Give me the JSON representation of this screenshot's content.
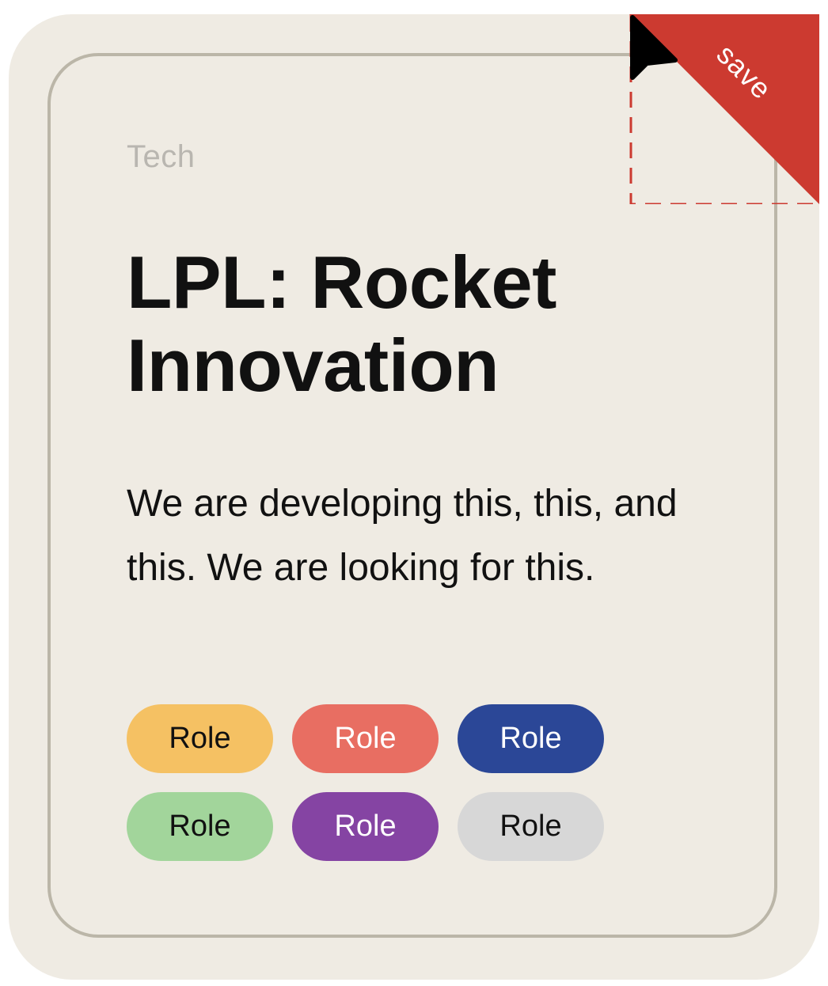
{
  "card": {
    "category": "Tech",
    "title": "LPL: Rocket Innovation",
    "description": "We are developing this, this, and this. We are looking for this.",
    "save_label": "save",
    "roles": [
      {
        "label": "Role",
        "bg": "#f5c163",
        "fg": "#111111"
      },
      {
        "label": "Role",
        "bg": "#e86e62",
        "fg": "#ffffff"
      },
      {
        "label": "Role",
        "bg": "#2b4797",
        "fg": "#ffffff"
      },
      {
        "label": "Role",
        "bg": "#a2d59b",
        "fg": "#111111"
      },
      {
        "label": "Role",
        "bg": "#8544a3",
        "fg": "#ffffff"
      },
      {
        "label": "Role",
        "bg": "#d7d7d7",
        "fg": "#111111"
      }
    ]
  },
  "colors": {
    "card_bg": "#efebe3",
    "frame_border": "#bbb6a8",
    "save_ribbon": "#cc3a30",
    "category_text": "#b9b6b0"
  },
  "icons": {
    "cursor": "mouse-pointer-icon"
  }
}
